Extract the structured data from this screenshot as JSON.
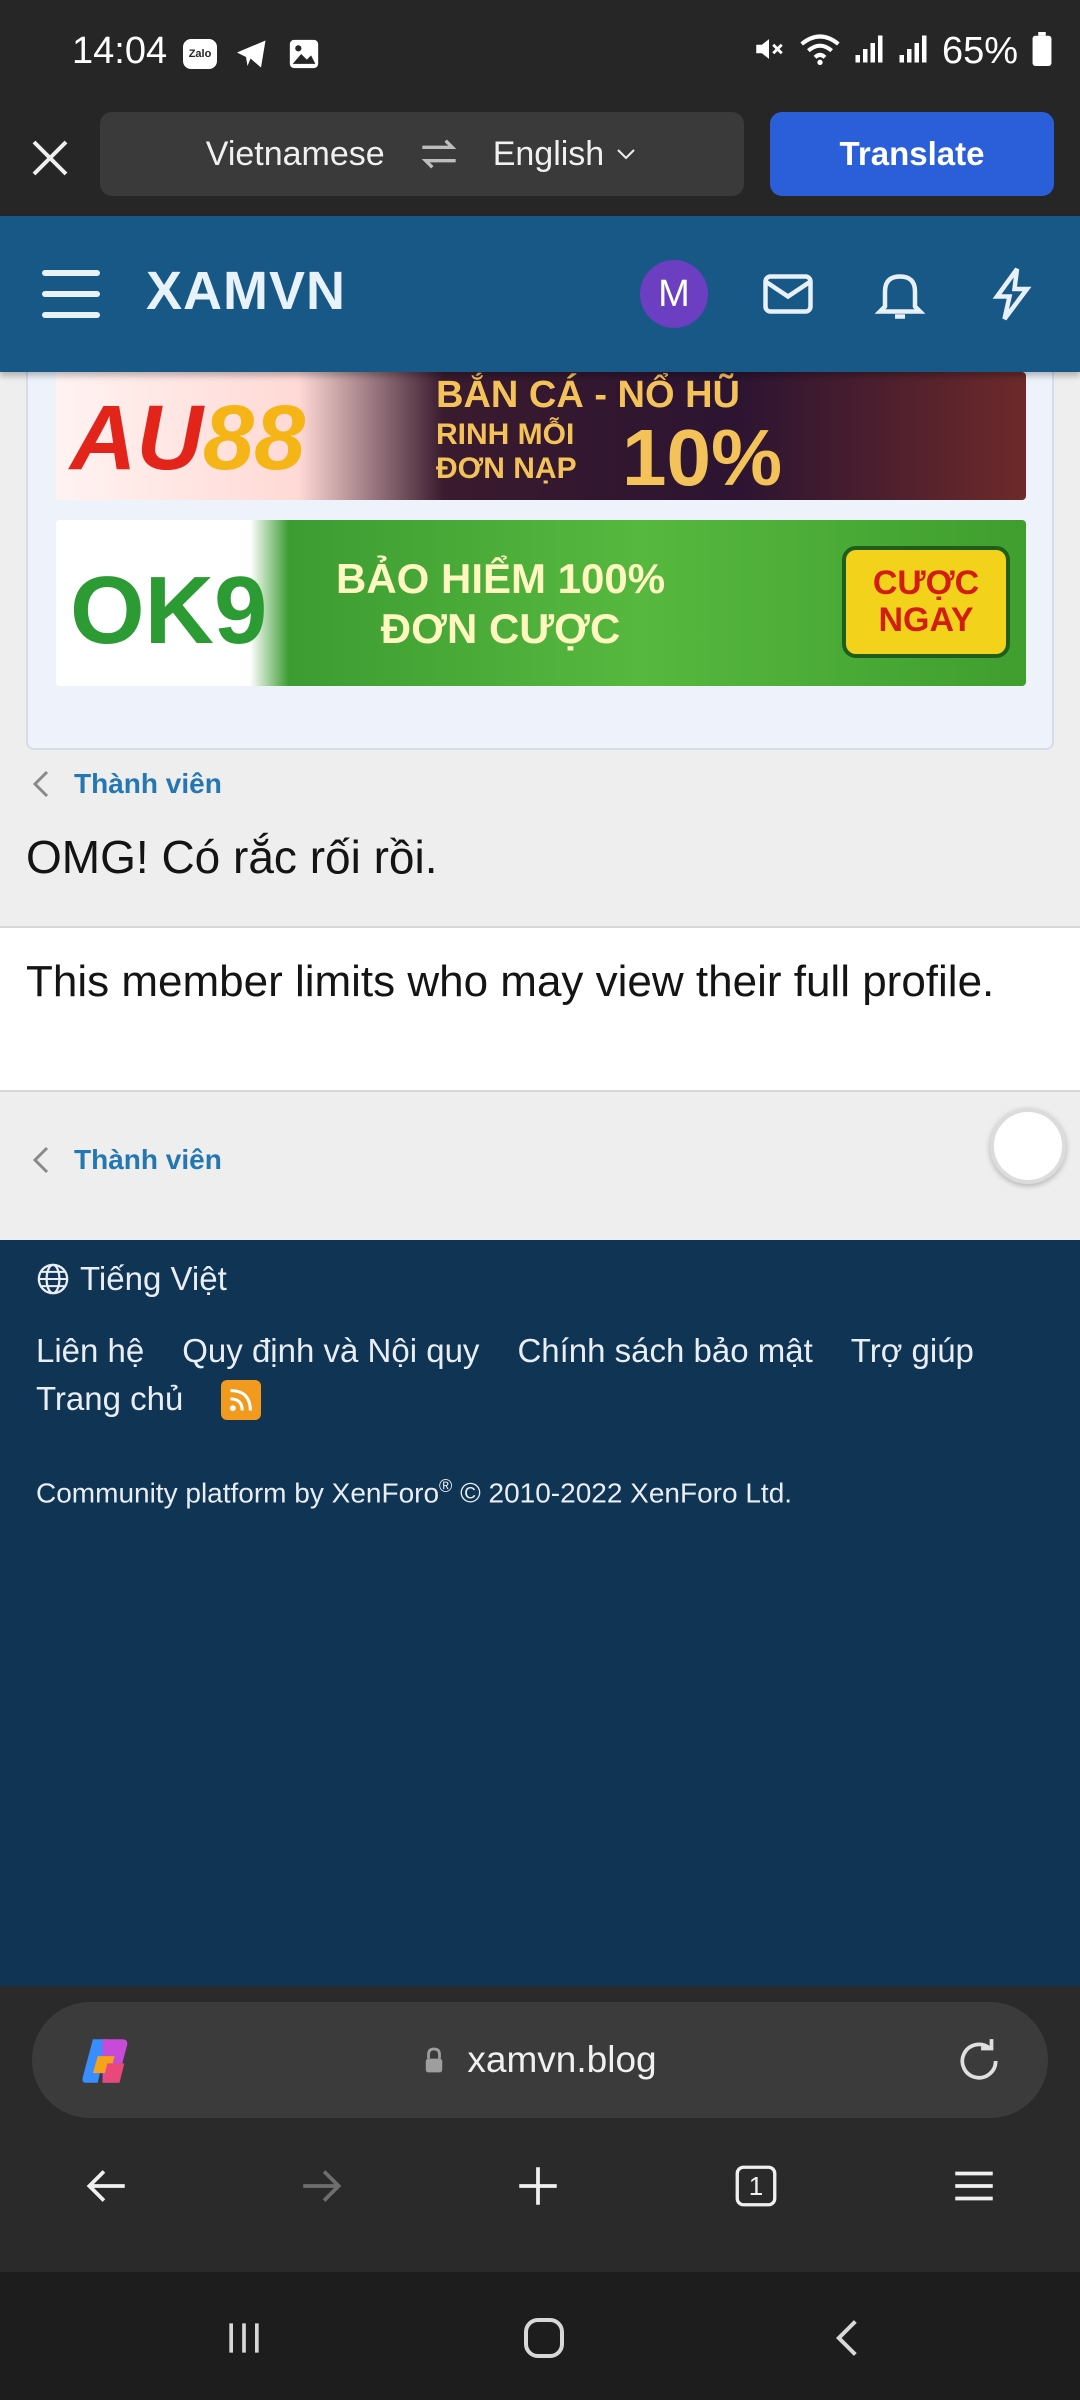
{
  "status_bar": {
    "time": "14:04",
    "notification_icons": [
      "zalo-icon",
      "telegram-icon",
      "gallery-icon"
    ],
    "zalo_label": "Zalo",
    "system_icons": [
      "mute-icon",
      "wifi-icon",
      "signal-icon",
      "signal-icon"
    ],
    "battery": "65%"
  },
  "translate_bar": {
    "from_language": "Vietnamese",
    "to_language": "English",
    "translate_label": "Translate"
  },
  "site_header": {
    "logo": "XAMVN",
    "avatar_initial": "M",
    "avatar_color": "#6c3ec2",
    "accent_color": "#185886"
  },
  "ads": {
    "banner1": {
      "brand_a": "AU",
      "brand_b": "88",
      "line1": "BẮN CÁ - NỔ HŨ",
      "line2": "RINH MỖI",
      "line3": "ĐƠN NẠP",
      "percent": "10%"
    },
    "banner2": {
      "brand": "OK9",
      "line1": "BẢO HIỂM 100%",
      "line2": "ĐƠN CƯỢC",
      "cta1": "CƯỢC",
      "cta2": "NGAY"
    }
  },
  "breadcrumb": {
    "label": "Thành viên"
  },
  "page": {
    "title": "OMG! Có rắc rối rồi.",
    "message": "This member limits who may view their full profile."
  },
  "footer": {
    "language": "Tiếng Việt",
    "links": [
      "Liên hệ",
      "Quy định và Nội quy",
      "Chính sách bảo mật",
      "Trợ giúp",
      "Trang chủ"
    ],
    "copyright_prefix": "Community platform by XenForo",
    "copyright_reg": "®",
    "copyright_suffix": " © 2010-2022 XenForo Ltd."
  },
  "browser": {
    "url": "xamvn.blog",
    "tab_count": "1"
  }
}
